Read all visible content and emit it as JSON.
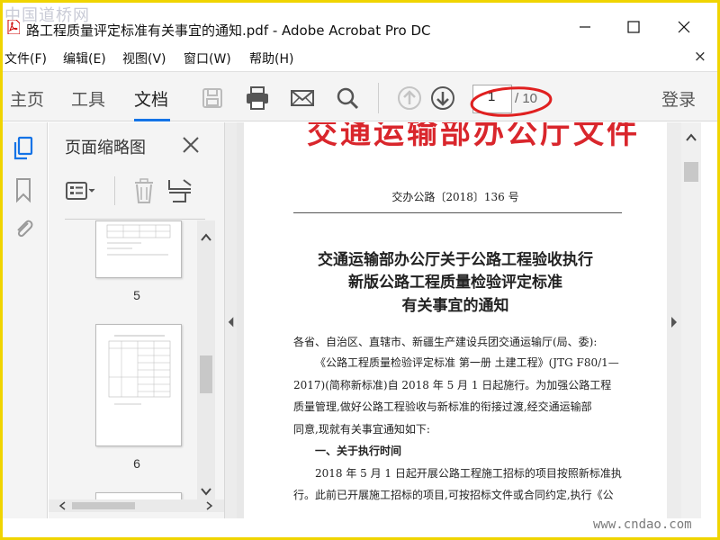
{
  "window": {
    "watermark": "中国道桥网",
    "title": "路工程质量评定标准有关事宜的通知.pdf - Adobe Acrobat Pro DC"
  },
  "menu": {
    "items": [
      "文件(F)",
      "编辑(E)",
      "视图(V)",
      "窗口(W)",
      "帮助(H)"
    ],
    "close_glyph": "×"
  },
  "toolbar": {
    "tabs": [
      "主页",
      "工具",
      "文档"
    ],
    "active_tab": "文档",
    "page_current": "1",
    "page_total": "/ 10",
    "login_label": "登录",
    "icons": [
      "save-icon",
      "print-icon",
      "email-icon",
      "search-icon",
      "page-up-icon",
      "page-down-icon"
    ]
  },
  "left_strip": {
    "icons": [
      "page-thumbnails-icon",
      "bookmark-icon",
      "attachment-icon"
    ]
  },
  "thumbnails": {
    "title": "页面缩略图",
    "pages": [
      {
        "label": "5"
      },
      {
        "label": "6"
      }
    ]
  },
  "document": {
    "header": "交通运输部办公厅文件",
    "doc_number": "交办公路〔2018〕136 号",
    "title_lines": [
      "交通运输部办公厅关于公路工程验收执行",
      "新版公路工程质量检验评定标准",
      "有关事宜的通知"
    ],
    "body_lines": [
      "各省、自治区、直辖市、新疆生产建设兵团交通运输厅(局、委):",
      "《公路工程质量检验评定标准 第一册 土建工程》(JTG F80/1—",
      "2017)(简称新标准)自 2018 年 5 月 1 日起施行。为加强公路工程",
      "质量管理,做好公路工程验收与新标准的衔接过渡,经交通运输部",
      "同意,现就有关事宜通知如下:",
      "一、关于执行时间",
      "2018 年 5 月 1 日起开展公路工程施工招标的项目按照新标准执",
      "行。此前已开展施工招标的项目,可按招标文件或合同约定,执行《公"
    ]
  },
  "watermark_bottom": "www.cndao.com",
  "colors": {
    "accent": "#1473e6",
    "header_red": "#d9262c",
    "annotation_red": "#e02020",
    "frame_yellow": "#f0d400"
  }
}
